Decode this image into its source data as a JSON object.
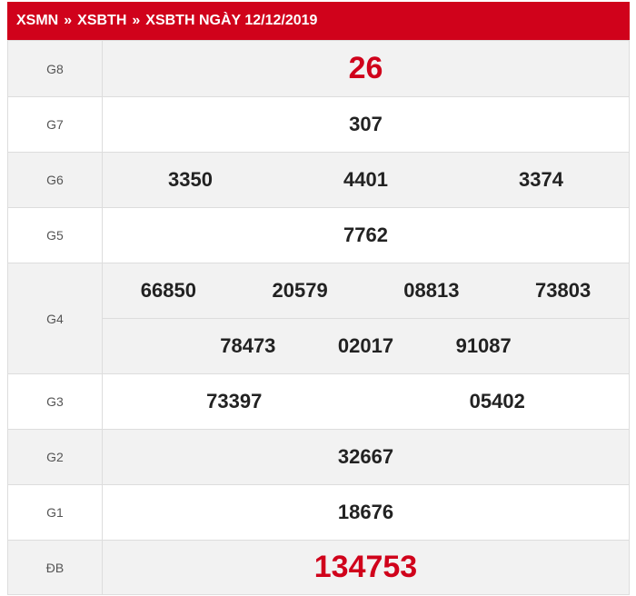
{
  "breadcrumb": {
    "items": [
      "XSMN",
      "XSBTH",
      "XSBTH NGÀY 12/12/2019"
    ],
    "separator": "»"
  },
  "colors": {
    "header_bg": "#d0021b",
    "highlight_red": "#d0021b",
    "row_gray": "#f2f2f2"
  },
  "prizes": {
    "g8": {
      "label": "G8",
      "numbers": [
        "26"
      ]
    },
    "g7": {
      "label": "G7",
      "numbers": [
        "307"
      ]
    },
    "g6": {
      "label": "G6",
      "numbers": [
        "3350",
        "4401",
        "3374"
      ]
    },
    "g5": {
      "label": "G5",
      "numbers": [
        "7762"
      ]
    },
    "g4": {
      "label": "G4",
      "numbers": [
        "66850",
        "20579",
        "08813",
        "73803",
        "78473",
        "02017",
        "91087"
      ]
    },
    "g3": {
      "label": "G3",
      "numbers": [
        "73397",
        "05402"
      ]
    },
    "g2": {
      "label": "G2",
      "numbers": [
        "32667"
      ]
    },
    "g1": {
      "label": "G1",
      "numbers": [
        "18676"
      ]
    },
    "db": {
      "label": "ĐB",
      "numbers": [
        "134753"
      ]
    }
  }
}
